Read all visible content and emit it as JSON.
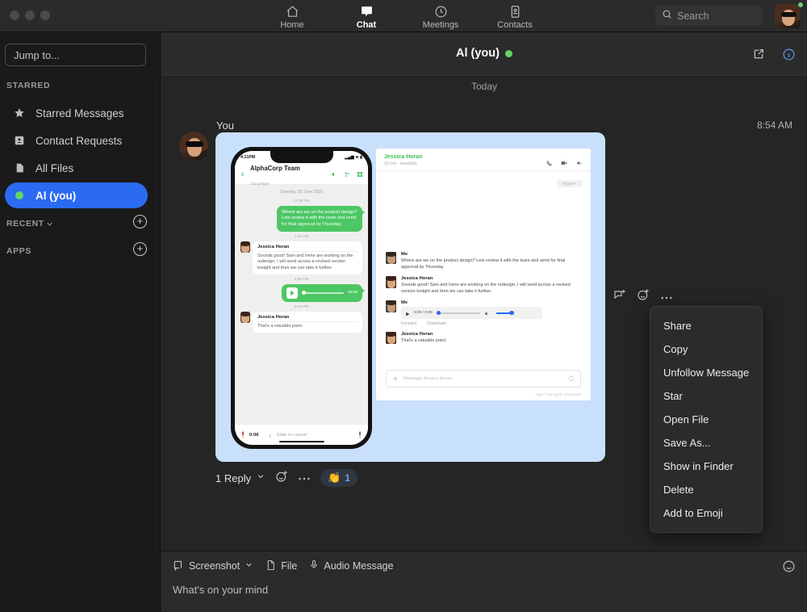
{
  "window": {
    "traffic_lights": [
      "close",
      "minimize",
      "maximize"
    ]
  },
  "topnav": {
    "tabs": [
      {
        "label": "Home",
        "icon": "home-icon",
        "active": false
      },
      {
        "label": "Chat",
        "icon": "chat-bubble-icon",
        "active": true
      },
      {
        "label": "Meetings",
        "icon": "clock-icon",
        "active": false
      },
      {
        "label": "Contacts",
        "icon": "contact-card-icon",
        "active": false
      }
    ],
    "search": {
      "placeholder": "Search",
      "icon": "search-icon"
    },
    "profile": {
      "name": "avatar",
      "status": "available",
      "status_color": "#6ece6e"
    }
  },
  "sidebar": {
    "jump_to": {
      "placeholder": "Jump to...",
      "value": ""
    },
    "sections": [
      {
        "label": "STARRED"
      },
      {
        "label": "RECENT",
        "chevron": "chevron-down-icon",
        "add": "plus-icon"
      },
      {
        "label": "APPS",
        "add": "plus-icon"
      }
    ],
    "items": [
      {
        "label": "Starred Messages",
        "icon": "star-icon",
        "selected": false
      },
      {
        "label": "Contact Requests",
        "icon": "contact-request-icon",
        "selected": false
      },
      {
        "label": "All Files",
        "icon": "files-icon",
        "selected": false
      },
      {
        "label": "Al  (you)",
        "icon": "presence-dot",
        "selected": true
      }
    ],
    "selected_color": "#2a6bf2"
  },
  "chat": {
    "title": "Al (you)",
    "status_color": "#64d26a",
    "header_icons": [
      "open-in-new-window-icon",
      "info-icon"
    ],
    "day_separator": "Today",
    "message": {
      "sender": "You",
      "time": "8:54 AM",
      "attachment_type": "screenshot",
      "reply_summary": "1 Reply",
      "reactions": [
        {
          "emoji": "👏",
          "count": "1"
        }
      ],
      "hover_actions": [
        "reply-in-thread-icon",
        "add-reaction-icon",
        "more-options-icon"
      ]
    }
  },
  "screenshot_content": {
    "phone": {
      "status_time": "4:21PM",
      "header_title": "AlphaCorp Team",
      "header_subtitle": "142 people",
      "header_icons": [
        "speaker-icon",
        "add-person-icon",
        "grid-icon"
      ],
      "date_separator": "Tuesday, 29 June 2020",
      "messages": [
        {
          "time": "12:29 PM",
          "side": "out",
          "text": "Where are we on the product design? Lets review it with the team and send for final approval by Thursday."
        },
        {
          "time": "1:43 PM",
          "side": "in",
          "sender": "Jessica Horan",
          "text": "Sounds good! Sam and Irene are working on the redesign. I will send across a revised version tonight and then we can take it further."
        },
        {
          "time": "2:25 PM",
          "side": "out",
          "type": "audio",
          "duration": "00:09"
        },
        {
          "time": "3:43 PM",
          "side": "in",
          "sender": "Jessica Horan",
          "text": "That's a valuable point."
        }
      ],
      "footer": {
        "recording_time": "0:06",
        "slide_label": "Slide to cancel",
        "mic_icon": "mic-icon"
      }
    },
    "desktop": {
      "contact_name": "Jessica Horan",
      "contact_meta": "10 min  ·  Available",
      "header_icons": [
        "phone-icon",
        "video-icon",
        "speaker-icon"
      ],
      "day_badge": "TODAY",
      "messages": [
        {
          "sender": "Me",
          "text": "Where are we on the product design? Lets review it with the team and send for final approval by Thursday"
        },
        {
          "sender": "Jessica Horan",
          "text": "Sounds good! Sam and Irene are working on the redesign. I will send across a revised version tonight and then we can take it further."
        },
        {
          "sender": "Me",
          "type": "audio",
          "position": "0:00 / 0:09",
          "actions": [
            "Forward",
            "Download"
          ]
        },
        {
          "sender": "Jessica Horan",
          "text": "That's a valuable point."
        }
      ],
      "input_placeholder": "Message Jessica Horan",
      "hint": "Type '/' for quick commands"
    }
  },
  "context_menu": {
    "items": [
      "Share",
      "Copy",
      "Unfollow Message",
      "Star",
      "Open File",
      "Save As...",
      "Show in Finder",
      "Delete",
      "Add to Emoji"
    ]
  },
  "composer": {
    "tools": [
      {
        "label": "Screenshot",
        "icon": "screenshot-icon",
        "has_chevron": true
      },
      {
        "label": "File",
        "icon": "file-icon",
        "has_chevron": false
      },
      {
        "label": "Audio Message",
        "icon": "mic-icon",
        "has_chevron": false
      }
    ],
    "input_placeholder": "What's on your mind",
    "emoji_icon": "emoji-icon"
  },
  "colors": {
    "accent": "#2a6bf2",
    "online": "#64d26a",
    "app_bg": "#252525",
    "sidebar_bg": "#1a1a1a",
    "bar_bg": "#2b2b2b",
    "screenshot_bg": "#c9e0fb",
    "bubble_green": "#4cc764"
  }
}
